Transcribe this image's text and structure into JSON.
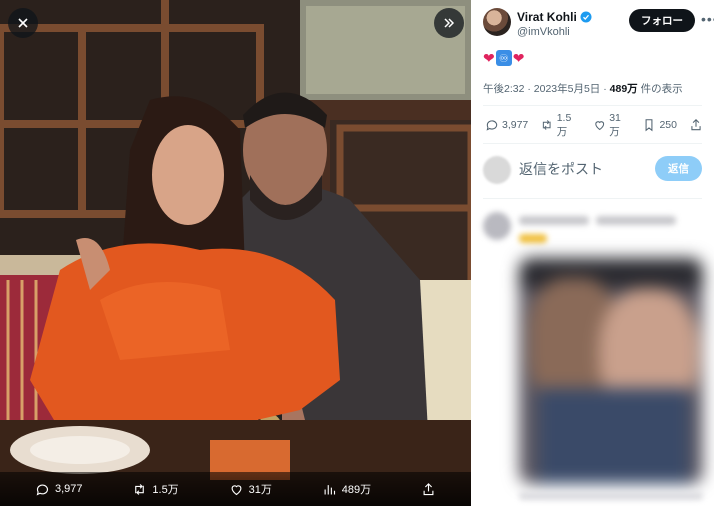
{
  "media": {
    "actions": {
      "replies": "3,977",
      "retweets": "1.5万",
      "likes": "31万",
      "views": "489万"
    }
  },
  "tweet": {
    "author_name": "Virat Kohli",
    "author_handle": "@imVkohli",
    "follow_label": "フォロー",
    "text_emoji": [
      "❤",
      "♾",
      "❤"
    ],
    "time": "午後2:32 · 2023年5月5日 · ",
    "view_count": "489万",
    "view_suffix": " 件の表示",
    "stats": {
      "replies": "3,977",
      "retweets": "1.5万",
      "likes": "31万",
      "bookmarks": "250"
    }
  },
  "reply": {
    "placeholder": "返信をポスト",
    "button_label": "返信"
  },
  "colors": {
    "verified": "#1d9bf0",
    "follow_bg": "#0f1419",
    "reply_button": "#8ecdf8",
    "heart": "#e0245e"
  },
  "icons": [
    "close-icon",
    "next-icon",
    "reply-icon",
    "retweet-icon",
    "like-icon",
    "views-icon",
    "share-icon",
    "bookmark-icon",
    "verified-icon",
    "more-icon"
  ]
}
